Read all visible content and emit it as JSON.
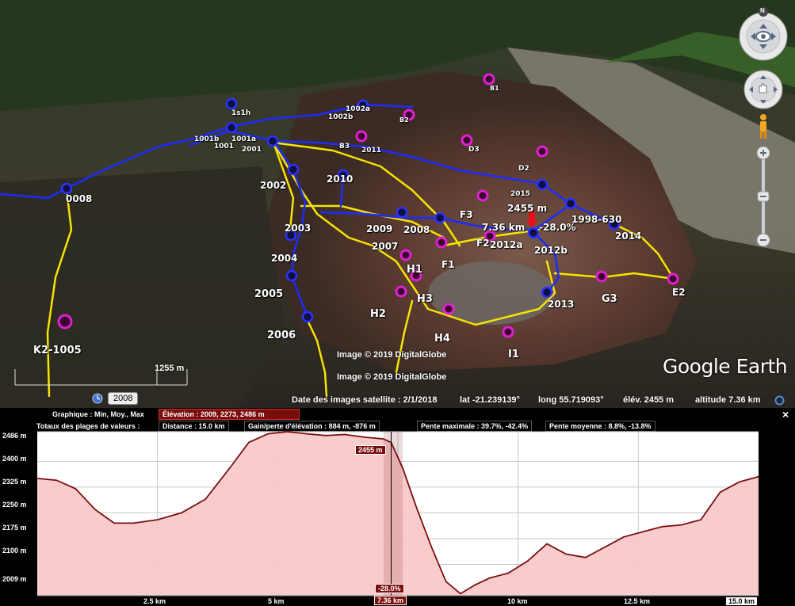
{
  "map": {
    "waypoints_dark": [
      {
        "label": "1s1h"
      },
      {
        "label": "1002a"
      },
      {
        "label": "1002b"
      },
      {
        "label": "1001a"
      },
      {
        "label": "1001b"
      },
      {
        "label": "1001"
      },
      {
        "label": "2001"
      },
      {
        "label": "0008"
      },
      {
        "label": "2002"
      },
      {
        "label": "2010"
      },
      {
        "label": "2003"
      },
      {
        "label": "2004"
      },
      {
        "label": "2005"
      },
      {
        "label": "2006"
      },
      {
        "label": "2009"
      },
      {
        "label": "2008"
      },
      {
        "label": "2007"
      },
      {
        "label": "2015"
      },
      {
        "label": "1998-630"
      },
      {
        "label": "2014"
      },
      {
        "label": "2012b"
      },
      {
        "label": "2013"
      }
    ],
    "waypoints_magenta": [
      {
        "label": "B1"
      },
      {
        "label": "B2"
      },
      {
        "label": "B3"
      },
      {
        "label": "2011"
      },
      {
        "label": "D3"
      },
      {
        "label": "D2"
      },
      {
        "label": "F3"
      },
      {
        "label": "F2"
      },
      {
        "label": "2012a"
      },
      {
        "label": "F1"
      },
      {
        "label": "H1"
      },
      {
        "label": "H3"
      },
      {
        "label": "H2"
      },
      {
        "label": "H4"
      },
      {
        "label": "I1"
      },
      {
        "label": "G3"
      },
      {
        "label": "E2"
      },
      {
        "label": "K2-1005"
      }
    ],
    "cursor": {
      "elevation": "2455 m",
      "distance": "7.36 km",
      "slope": "-28.0%"
    },
    "copyright_1": "Image © 2019 DigitalGlobe",
    "copyright_2": "Image © 2019 DigitalGlobe",
    "logo": "Google Earth",
    "scale": "1255  m",
    "year": "2008",
    "status": {
      "imagery_date": "Date des images satellite : 2/1/2018",
      "lat": "lat  -21.239139°",
      "long": "long  55.719093°",
      "elev": "élév. 2455 m",
      "altitude": "altitude  7.36 km"
    },
    "compass_letter": "N"
  },
  "profile": {
    "graph_label": "Graphique : Min, Moy., Max",
    "elevation_box": "Élévation : 2009, 2273, 2486 m",
    "totals_label": "Totaux des plages de valeurs :",
    "distance": "Distance : 15.0 km",
    "gain_loss": "Gain/perte d'élévation : 884 m, -876 m",
    "max_slope": "Pente maximale : 39.7%, -42.4%",
    "avg_slope": "Pente moyenne : 8.8%, -13.8%",
    "close": "×",
    "y_ticks": [
      "2486 m",
      "2400 m",
      "2325 m",
      "2250 m",
      "2175 m",
      "2100 m",
      "2009 m"
    ],
    "x_ticks": [
      "2.5 km",
      "5 km",
      "10 km",
      "12.5 km",
      "15.0 km"
    ],
    "cursor_x_label": "7.36 km",
    "cursor_elev_label": "2455 m",
    "cursor_slope_label": "-28.0%",
    "line_color": "#7a0e0e",
    "fill_color": "#f7c6c8"
  },
  "chart_data": {
    "type": "area",
    "xlabel": "",
    "ylabel": "",
    "xlim": [
      0,
      15
    ],
    "ylim": [
      2009,
      2486
    ],
    "x": [
      0,
      0.4,
      0.8,
      1.2,
      1.6,
      2.0,
      2.5,
      3.0,
      3.5,
      4.0,
      4.4,
      4.8,
      5.2,
      5.6,
      6.0,
      6.4,
      6.8,
      7.2,
      7.36,
      7.6,
      7.9,
      8.2,
      8.5,
      8.8,
      9.1,
      9.4,
      9.8,
      10.2,
      10.6,
      11.0,
      11.4,
      11.8,
      12.2,
      12.6,
      13.0,
      13.4,
      13.8,
      14.2,
      14.6,
      15.0
    ],
    "y": [
      2350,
      2345,
      2320,
      2260,
      2220,
      2220,
      2230,
      2250,
      2290,
      2380,
      2455,
      2480,
      2486,
      2480,
      2475,
      2478,
      2470,
      2465,
      2455,
      2380,
      2260,
      2150,
      2050,
      2015,
      2040,
      2060,
      2075,
      2110,
      2160,
      2130,
      2120,
      2150,
      2180,
      2195,
      2210,
      2215,
      2230,
      2310,
      2340,
      2355
    ],
    "grid": true
  }
}
